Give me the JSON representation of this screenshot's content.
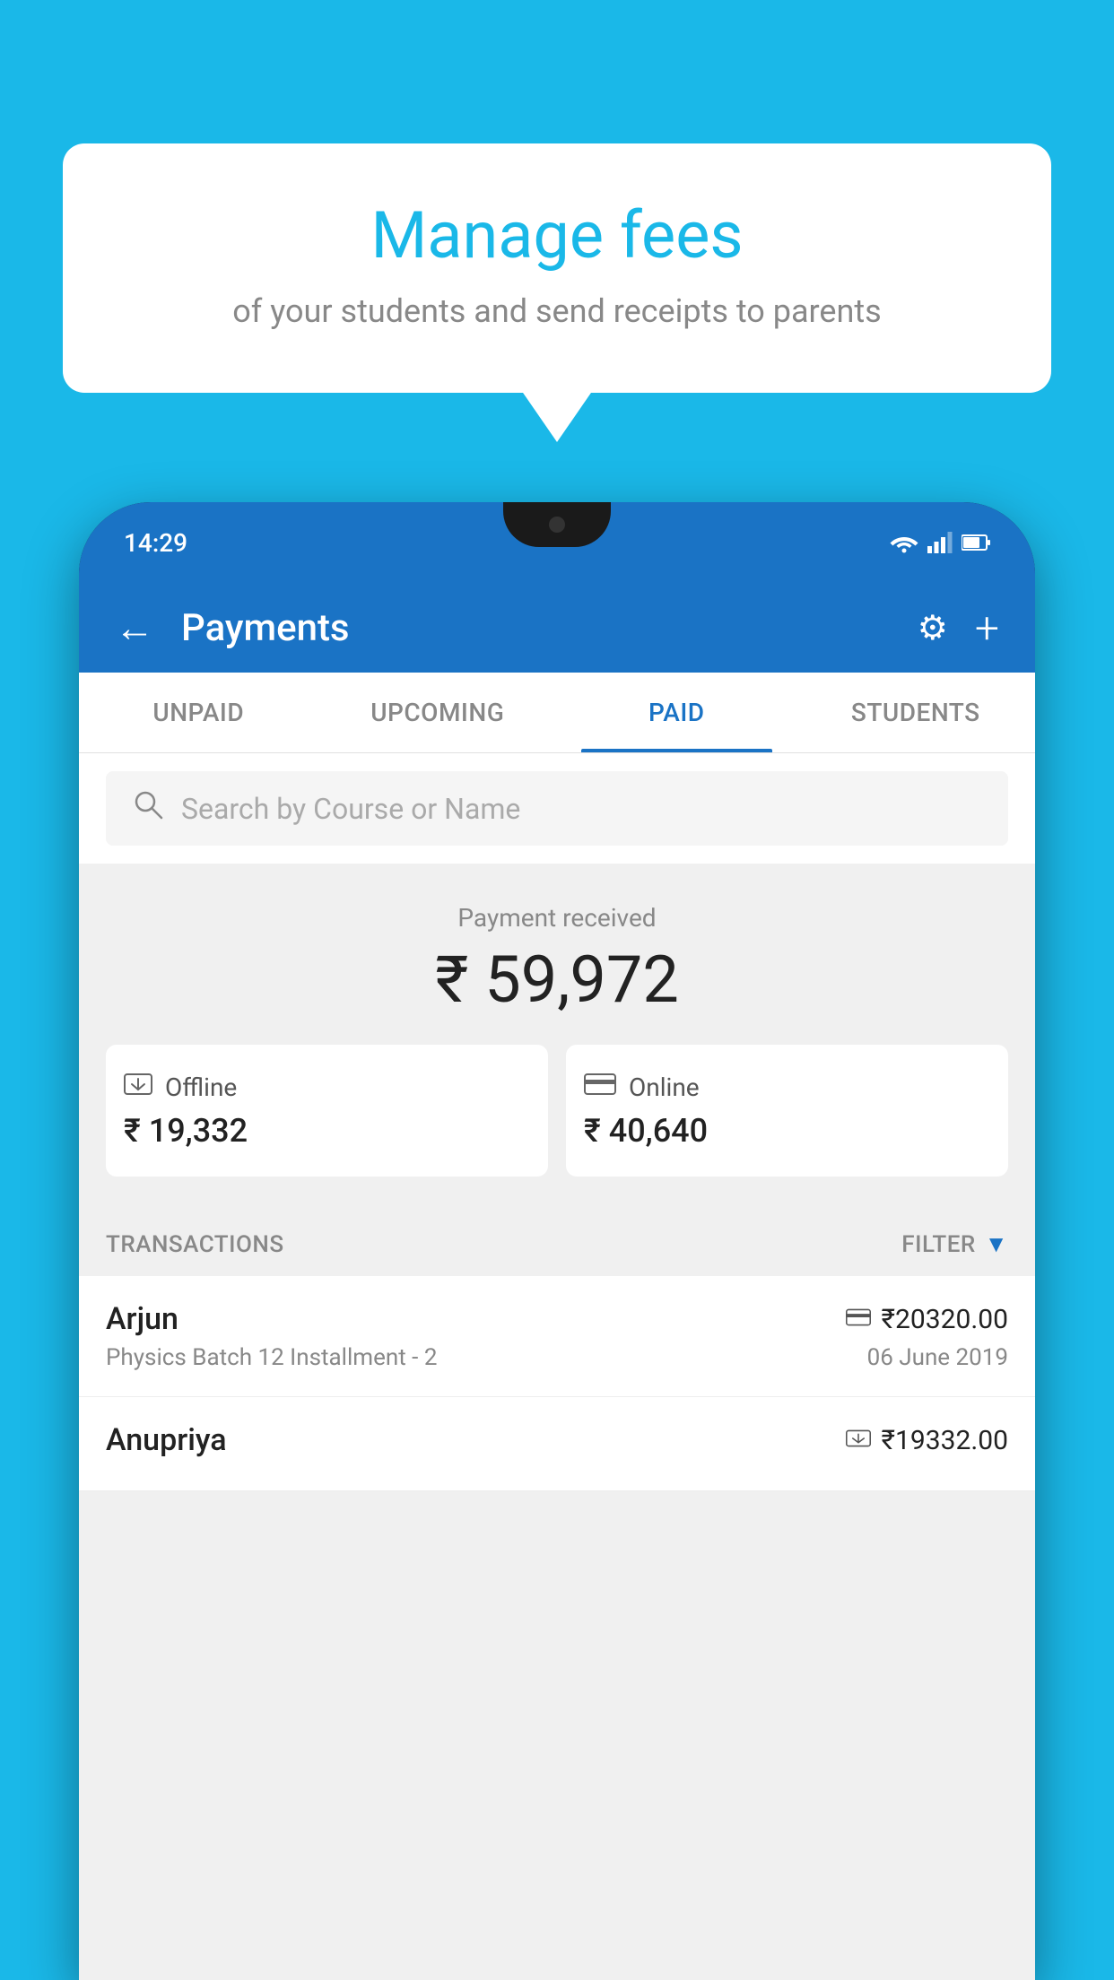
{
  "background_color": "#1ab8e8",
  "speech_bubble": {
    "title": "Manage fees",
    "subtitle": "of your students and send receipts to parents"
  },
  "phone": {
    "status_bar": {
      "time": "14:29",
      "wifi_icon": "▼",
      "signal_icon": "▲",
      "battery_icon": "▐"
    },
    "header": {
      "back_label": "←",
      "title": "Payments",
      "settings_icon": "⚙",
      "add_icon": "+"
    },
    "tabs": [
      {
        "label": "UNPAID",
        "active": false
      },
      {
        "label": "UPCOMING",
        "active": false
      },
      {
        "label": "PAID",
        "active": true
      },
      {
        "label": "STUDENTS",
        "active": false
      }
    ],
    "search": {
      "placeholder": "Search by Course or Name"
    },
    "payment_summary": {
      "label": "Payment received",
      "amount": "₹ 59,972",
      "offline": {
        "label": "Offline",
        "amount": "₹ 19,332"
      },
      "online": {
        "label": "Online",
        "amount": "₹ 40,640"
      }
    },
    "transactions": {
      "header_label": "TRANSACTIONS",
      "filter_label": "FILTER",
      "items": [
        {
          "name": "Arjun",
          "course": "Physics Batch 12 Installment - 2",
          "amount": "₹20320.00",
          "date": "06 June 2019",
          "type": "online"
        },
        {
          "name": "Anupriya",
          "course": "",
          "amount": "₹19332.00",
          "date": "",
          "type": "offline"
        }
      ]
    }
  }
}
